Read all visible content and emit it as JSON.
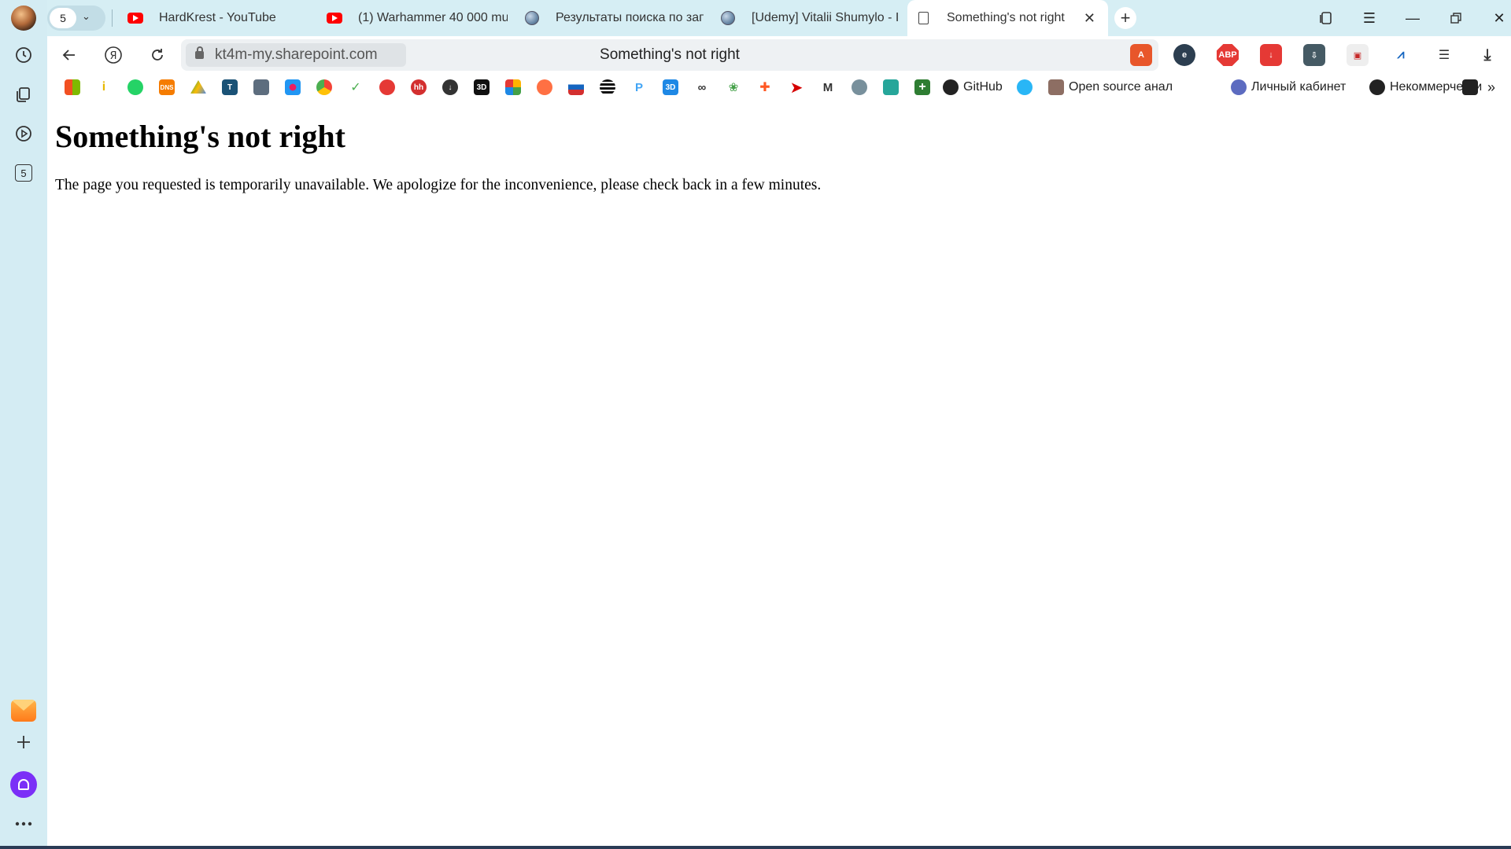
{
  "window": {
    "tab_count": "5",
    "tabs": [
      {
        "title": "HardKrest - YouTube",
        "favicon": "youtube-icon"
      },
      {
        "title": "(1) Warhammer 40 000 mu",
        "favicon": "youtube-icon"
      },
      {
        "title": "Результаты поиска по зап",
        "favicon": "globe-icon"
      },
      {
        "title": "[Udemy] Vitalii Shumylo - I",
        "favicon": "globe-icon"
      },
      {
        "title": "Something's not right",
        "favicon": "page-icon",
        "active": true
      }
    ]
  },
  "address_bar": {
    "url": "kt4m-my.sharepoint.com",
    "page_title": "Something's not right"
  },
  "bookmarks": [
    {
      "label": "GitHub"
    },
    {
      "label": "Open source анал"
    },
    {
      "label": "Личный кабинет"
    },
    {
      "label": "Некоммерчески"
    }
  ],
  "content": {
    "heading": "Something's not right",
    "message": "The page you requested is temporarily unavailable. We apologize for the inconvenience, please check back in a few minutes."
  },
  "colors": {
    "chrome_bg": "#d4ecf3",
    "active_tab": "#ffffff",
    "alice_purple": "#7b2ff7"
  }
}
